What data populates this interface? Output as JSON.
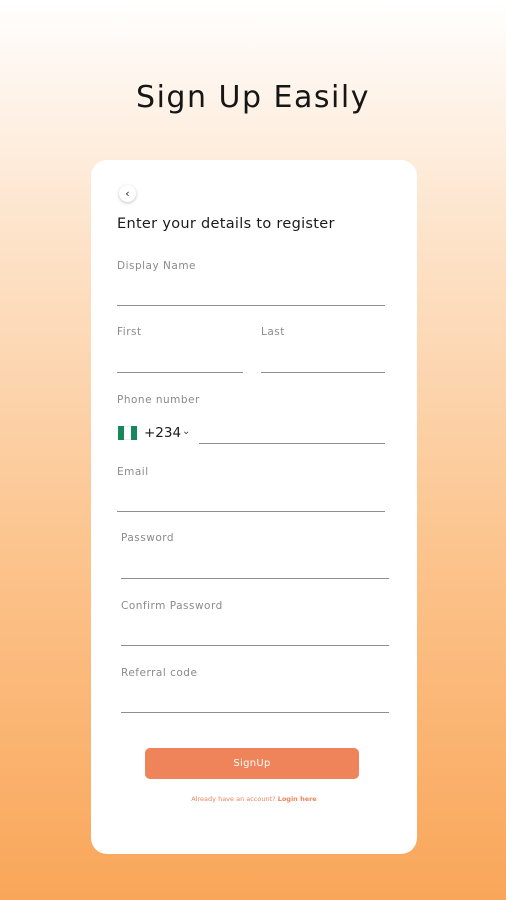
{
  "page": {
    "headline": "Sign Up Easily"
  },
  "form": {
    "subtitle": "Enter your details to register",
    "display_name_label": "Display Name",
    "first_label": "First",
    "last_label": "Last",
    "phone_label": "Phone number",
    "country_code": "+234",
    "email_label": "Email",
    "password_label": "Password",
    "confirm_password_label": "Confirm Password",
    "referral_label": "Referral code",
    "signup_label": "SignUp",
    "footer_prompt": "Already have an account?",
    "footer_link": "Login here"
  },
  "icons": {
    "back": "chevron-left-icon",
    "flag": "nigeria-flag-icon",
    "dropdown": "chevron-down-icon"
  },
  "colors": {
    "accent": "#ef845b",
    "flag_green": "#16885a",
    "flag_white": "#ffffff"
  }
}
